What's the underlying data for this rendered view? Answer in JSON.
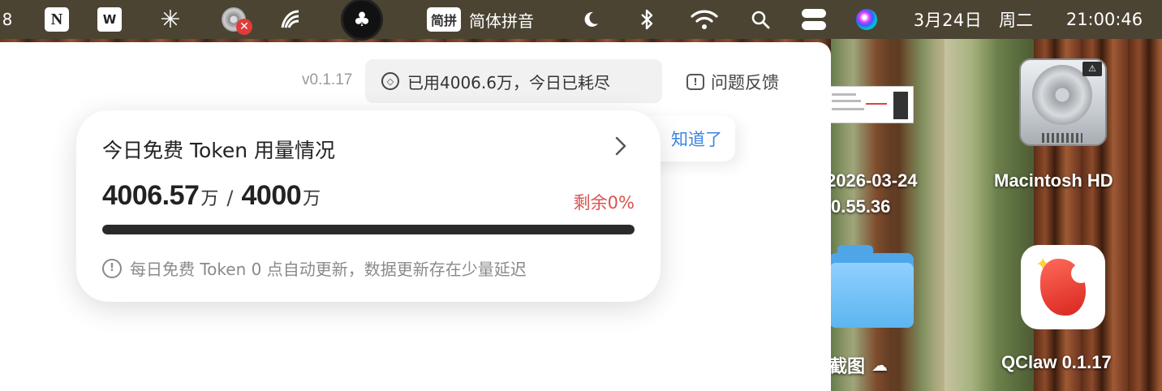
{
  "menubar": {
    "left_digit": "8",
    "notion_letter": "N",
    "wps_letter": "W",
    "ime_badge": "简拼",
    "ime_label": "简体拼音",
    "date": "3月24日",
    "weekday": "周二",
    "time": "21:00:46"
  },
  "app": {
    "version": "v0.1.17",
    "usage_chip_text": "已用4006.6万，今日已耗尽",
    "feedback_label": "问题反馈",
    "gotit_label": "知道了"
  },
  "token_card": {
    "title": "今日免费 Token 用量情况",
    "used_value": "4006.57",
    "used_unit": "万",
    "slash": "/",
    "limit_value": "4000",
    "limit_unit": "万",
    "remaining_label": "剩余0%",
    "progress_fraction": 1.0,
    "note": "每日免费 Token 0 点自动更新，数据更新存在少量延迟"
  },
  "desktop": {
    "screenshot_label_line1": "2026-03-24",
    "screenshot_label_line2": "0.55.36",
    "hd_label": "Macintosh HD",
    "folder_label": "截图",
    "qclaw_label": "QClaw 0.1.17"
  },
  "colors": {
    "accent_blue": "#3b86e0",
    "warning_red": "#d9534f",
    "progress_fill": "#2a2a2a",
    "menubar_bg": "#4b4433"
  },
  "icons": [
    "notion-icon",
    "wps-icon",
    "burst-icon",
    "disc-error-icon",
    "pen-icon",
    "tree-icon",
    "moon-icon",
    "bluetooth-icon",
    "wifi-icon",
    "search-icon",
    "control-center-icon",
    "siri-icon",
    "token-icon",
    "feedback-icon",
    "chevron-right-icon",
    "info-icon",
    "cloud-icon"
  ]
}
